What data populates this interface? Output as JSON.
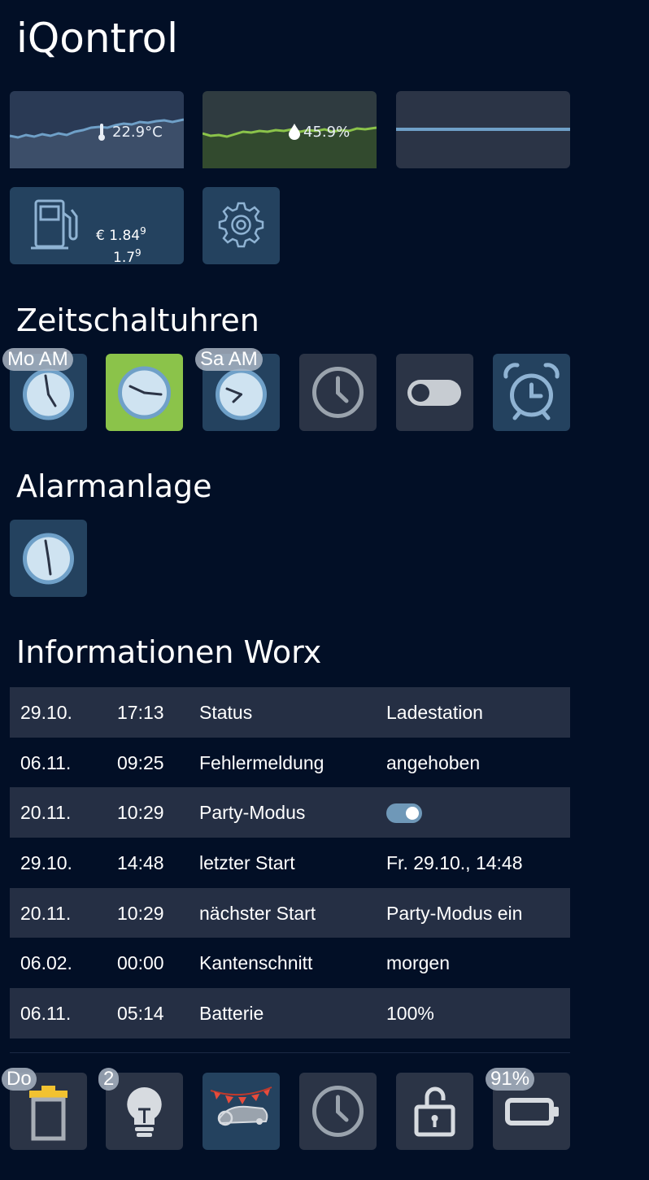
{
  "app": {
    "title": "iQontrol"
  },
  "top_row": {
    "temperature": {
      "label": "22.9°C",
      "icon": "thermometer-icon",
      "color": "#6fa0c8"
    },
    "humidity": {
      "label": "45.9%",
      "icon": "droplet-icon",
      "color": "#8bc34a"
    },
    "third_chart": {
      "color": "#6fa0c8"
    }
  },
  "fuel": {
    "icon": "fuel-pump-icon",
    "price1": "€ 1.84",
    "price1_sup": "9",
    "price2": "1.7",
    "price2_sup": "9"
  },
  "settings": {
    "icon": "gear-icon"
  },
  "sections": {
    "timers": "Zeitschaltuhren",
    "alarm": "Alarmanlage",
    "worx": "Informationen Worx"
  },
  "timers": [
    {
      "name": "timer-mo",
      "badge": "Mo AM",
      "icon": "clock-icon"
    },
    {
      "name": "timer-active",
      "badge": "",
      "icon": "clock-icon"
    },
    {
      "name": "timer-sa",
      "badge": "Sa AM",
      "icon": "clock-icon"
    },
    {
      "name": "timer-outline",
      "badge": "",
      "icon": "clock-outline-icon"
    },
    {
      "name": "timer-toggle",
      "badge": "",
      "icon": "toggle-off-icon"
    },
    {
      "name": "alarm-clock",
      "badge": "",
      "icon": "alarm-clock-icon"
    }
  ],
  "alarm": {
    "icon": "clock-icon"
  },
  "worx_table": [
    {
      "date": "29.10.",
      "time": "17:13",
      "label": "Status",
      "value": "Ladestation"
    },
    {
      "date": "06.11.",
      "time": "09:25",
      "label": "Fehlermeldung",
      "value": "angehoben"
    },
    {
      "date": "20.11.",
      "time": "10:29",
      "label": "Party-Modus",
      "value": "",
      "toggle": true
    },
    {
      "date": "29.10.",
      "time": "14:48",
      "label": "letzter Start",
      "value": "Fr. 29.10., 14:48"
    },
    {
      "date": "20.11.",
      "time": "10:29",
      "label": "nächster Start",
      "value": "Party-Modus ein"
    },
    {
      "date": "06.02.",
      "time": "00:00",
      "label": "Kantenschnitt",
      "value": "morgen"
    },
    {
      "date": "06.11.",
      "time": "05:14",
      "label": "Batterie",
      "value": "100%"
    }
  ],
  "bottom_row": [
    {
      "name": "trash-tile",
      "badge": "Do",
      "icon": "trash-can-icon"
    },
    {
      "name": "lightbulb-tile",
      "badge": "2",
      "icon": "lightbulb-icon"
    },
    {
      "name": "party-tile",
      "badge": "",
      "icon": "party-mower-icon"
    },
    {
      "name": "clock-tile",
      "badge": "",
      "icon": "clock-outline-icon"
    },
    {
      "name": "lock-tile",
      "badge": "",
      "icon": "unlock-icon"
    },
    {
      "name": "battery-tile",
      "badge": "91%",
      "icon": "battery-icon"
    }
  ]
}
